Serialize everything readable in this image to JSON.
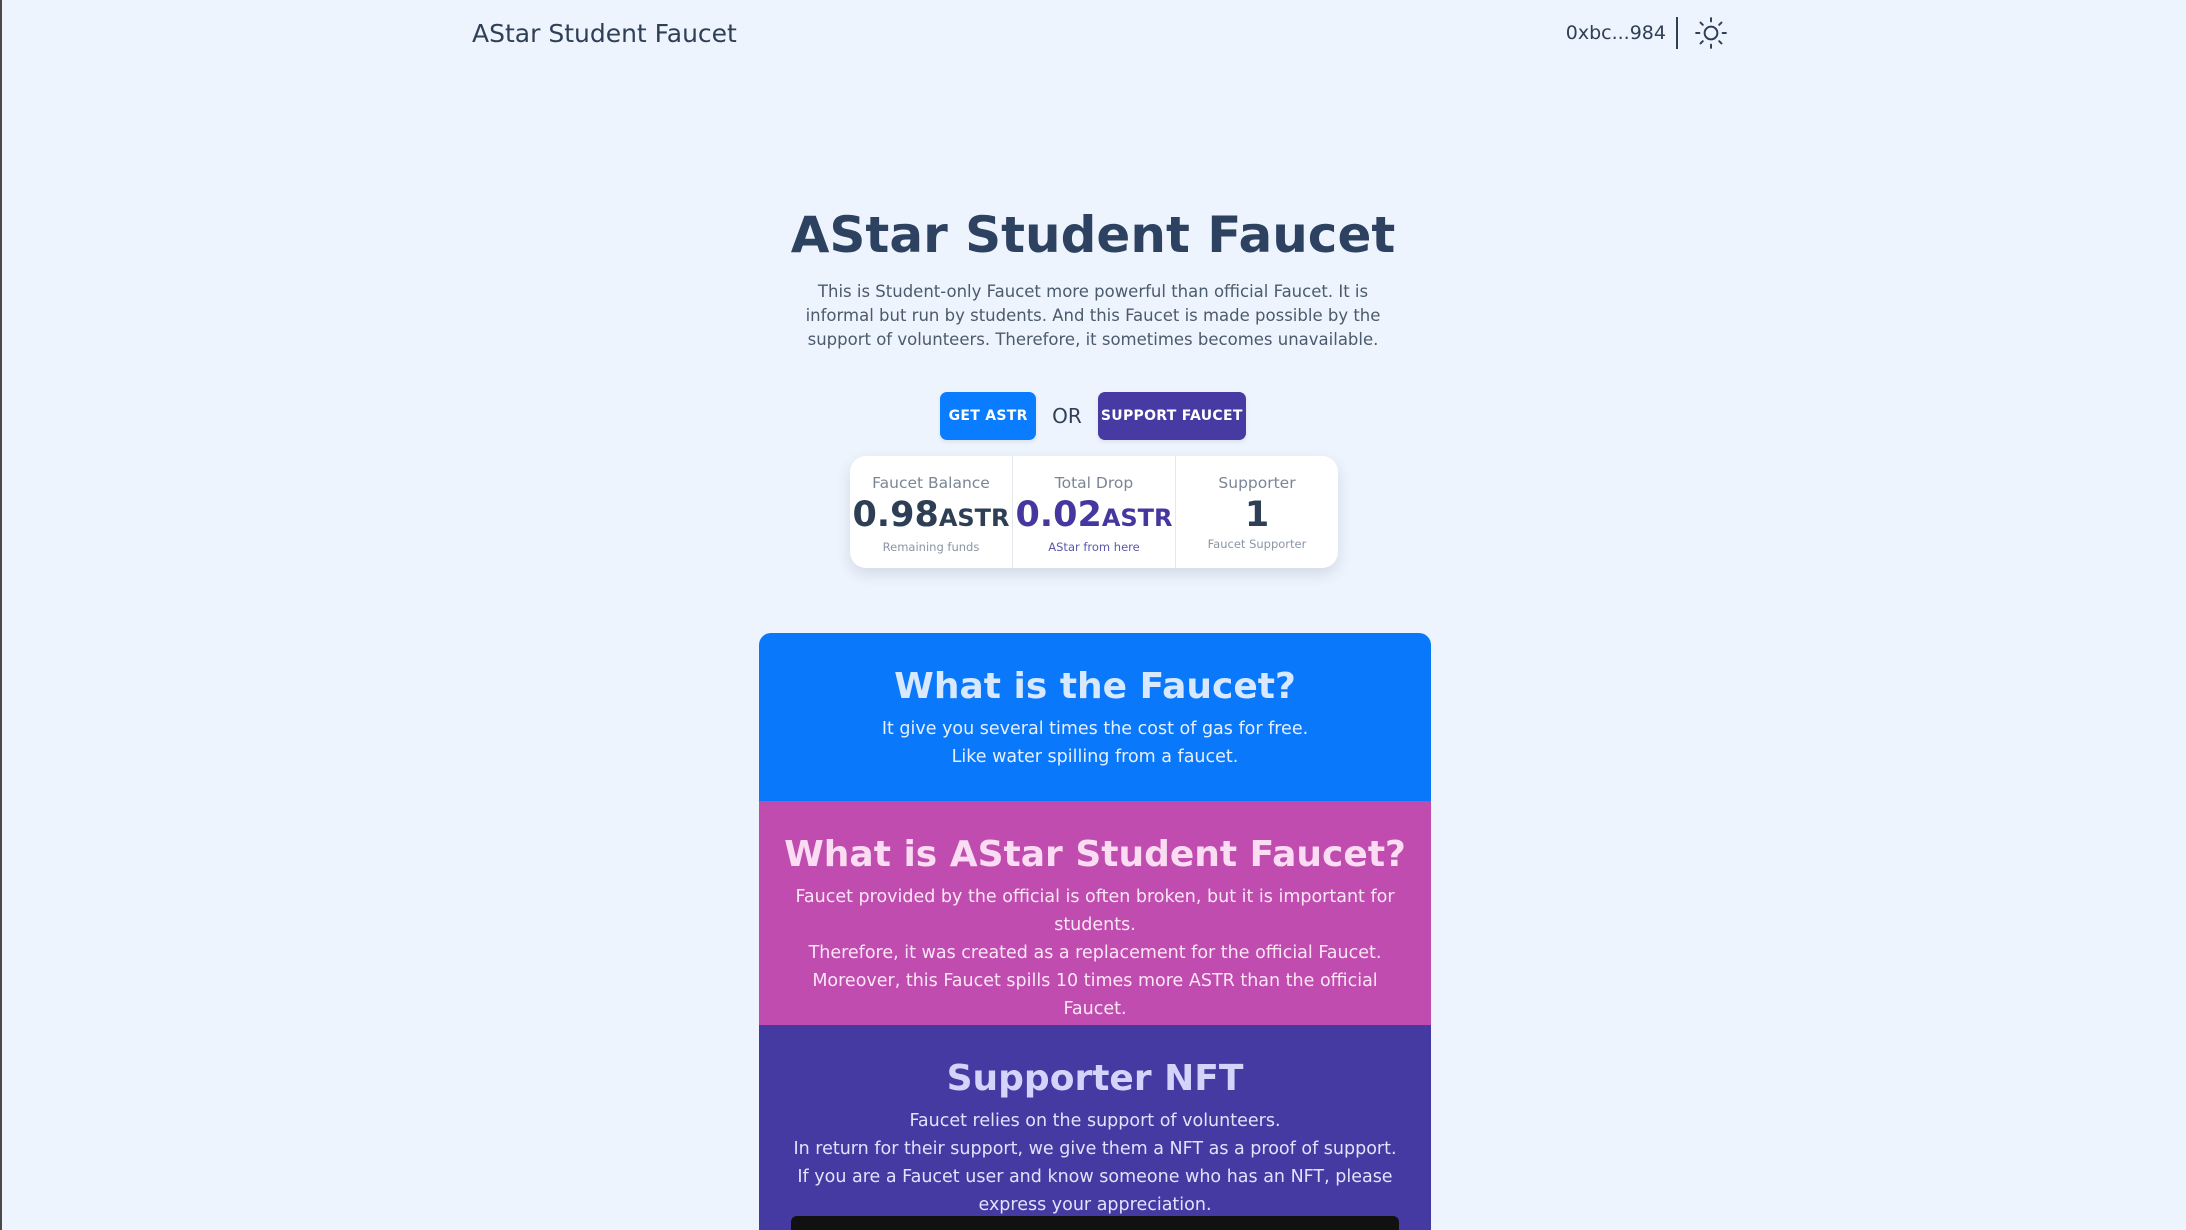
{
  "header": {
    "brand": "AStar Student Faucet",
    "wallet_address": "0xbc...984",
    "theme_icon": "sun-icon"
  },
  "hero": {
    "title": "AStar Student Faucet",
    "description": "This is Student-only Faucet more powerful than official Faucet. It is informal but run by students. And this Faucet is made possible by the support of volunteers. Therefore, it sometimes becomes unavailable."
  },
  "actions": {
    "get_label": "GET ASTR",
    "or_label": "OR",
    "support_label": "SUPPORT FAUCET"
  },
  "stats": [
    {
      "title": "Faucet Balance",
      "value": "0.98",
      "unit": "ASTR",
      "desc": "Remaining funds"
    },
    {
      "title": "Total Drop",
      "value": "0.02",
      "unit": "ASTR",
      "desc": "AStar from here"
    },
    {
      "title": "Supporter",
      "value": "1",
      "unit": "",
      "desc": "Faucet Supporter"
    }
  ],
  "sections": {
    "what_faucet": {
      "heading": "What is the Faucet?",
      "lines": [
        "It give you several times the cost of gas for free.",
        "Like water spilling from a faucet."
      ]
    },
    "what_astar": {
      "heading": "What is AStar Student Faucet?",
      "lines": [
        "Faucet provided by the official is often broken, but it is important for students.",
        "Therefore, it was created as a replacement for the official Faucet.",
        "Moreover, this Faucet spills 10 times more ASTR than the official Faucet."
      ]
    },
    "supporter_nft": {
      "heading": "Supporter NFT",
      "lines": [
        "Faucet relies on the support of volunteers.",
        "In return for their support, we give them a NFT as a proof of support.",
        "If you are a Faucet user and know someone who has an NFT, please express your appreciation."
      ]
    }
  },
  "colors": {
    "background": "#eef4fd",
    "primary": "#0a7cff",
    "secondary": "#473aa3",
    "card_blue": "#0a78fb",
    "card_pink": "#c14caf",
    "card_purple": "#4539a2"
  }
}
